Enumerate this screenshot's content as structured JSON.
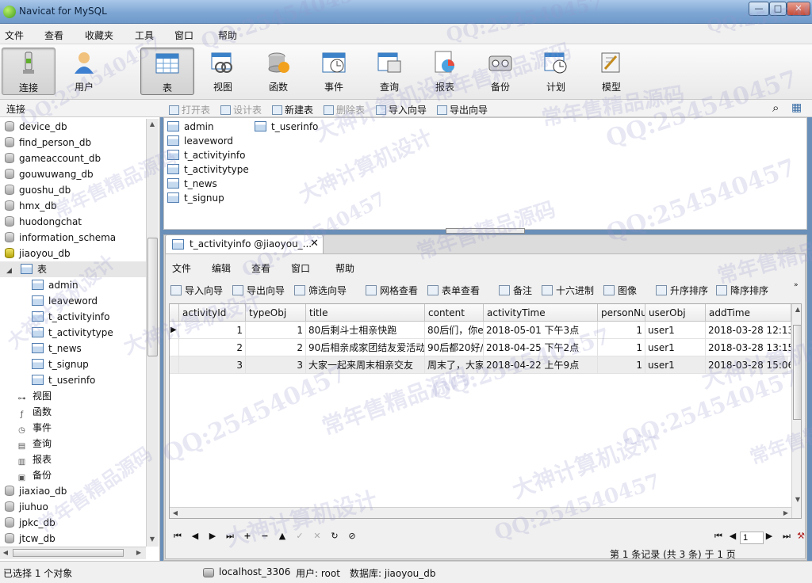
{
  "window": {
    "title": "Navicat for MySQL",
    "min": "—",
    "max": "□",
    "close": "✕"
  },
  "menu": [
    "文件",
    "查看",
    "收藏夹",
    "工具",
    "窗口",
    "帮助"
  ],
  "toolbar": [
    {
      "label": "连接",
      "icon": "connection-icon"
    },
    {
      "label": "用户",
      "icon": "user-icon"
    },
    {
      "label": "表",
      "icon": "table-icon",
      "active": true
    },
    {
      "label": "视图",
      "icon": "view-icon"
    },
    {
      "label": "函数",
      "icon": "function-icon"
    },
    {
      "label": "事件",
      "icon": "event-icon"
    },
    {
      "label": "查询",
      "icon": "query-icon"
    },
    {
      "label": "报表",
      "icon": "report-icon"
    },
    {
      "label": "备份",
      "icon": "backup-icon"
    },
    {
      "label": "计划",
      "icon": "schedule-icon"
    },
    {
      "label": "模型",
      "icon": "model-icon"
    }
  ],
  "sidebar_header": "连接",
  "object_toolbar": [
    {
      "label": "打开表",
      "disabled": true
    },
    {
      "label": "设计表",
      "disabled": true
    },
    {
      "label": "新建表",
      "disabled": false
    },
    {
      "label": "删除表",
      "disabled": true
    },
    {
      "label": "导入向导",
      "disabled": false
    },
    {
      "label": "导出向导",
      "disabled": false
    }
  ],
  "tree": {
    "dbs_top": [
      "device_db",
      "find_person_db",
      "gameaccount_db",
      "gouwuwang_db",
      "guoshu_db",
      "hmx_db",
      "huodongchat",
      "information_schema"
    ],
    "open_db": "jiaoyou_db",
    "tables_node": "表",
    "tables": [
      "admin",
      "leaveword",
      "t_activityinfo",
      "t_activitytype",
      "t_news",
      "t_signup",
      "t_userinfo"
    ],
    "objects": [
      "视图",
      "函数",
      "事件",
      "查询",
      "报表",
      "备份"
    ],
    "dbs_bottom": [
      "jiaxiao_db",
      "jiuhuo",
      "jpkc_db",
      "jtcw_db"
    ]
  },
  "object_list": [
    "admin",
    "leaveword",
    "t_activityinfo",
    "t_activitytype",
    "t_news",
    "t_signup",
    "t_userinfo"
  ],
  "doc_tab": {
    "label": "t_activityinfo @jiaoyou_...",
    "close": "✕"
  },
  "doc_menu": [
    "文件",
    "编辑",
    "查看",
    "窗口",
    "帮助"
  ],
  "doc_toolbar": [
    "导入向导",
    "导出向导",
    "筛选向导",
    "网格查看",
    "表单查看",
    "备注",
    "十六进制",
    "图像",
    "升序排序",
    "降序排序"
  ],
  "grid": {
    "columns": [
      "activityId",
      "typeObj",
      "title",
      "content",
      "activityTime",
      "personNu",
      "userObj",
      "addTime"
    ],
    "rows": [
      [
        "1",
        "1",
        "80后剩斗士相亲快跑",
        "80后们，你e",
        "2018-05-01 下午3点",
        "1",
        "user1",
        "2018-03-28 12:13:"
      ],
      [
        "2",
        "2",
        "90后相亲成家团结友爱活动",
        "90后都20好/",
        "2018-04-25 下午2点",
        "1",
        "user1",
        "2018-03-28 13:15:"
      ],
      [
        "3",
        "3",
        "大家一起来周末相亲交友",
        "周末了，大家",
        "2018-04-22 上午9点",
        "1",
        "user1",
        "2018-03-28 15:06:"
      ]
    ],
    "current_row": 0
  },
  "nav": {
    "page": "1",
    "record_status": "第 1 条记录 (共 3 条) 于 1 页"
  },
  "status": {
    "selected": "已选择 1 个对象",
    "host": "localhost_3306",
    "user": "用户: root",
    "database": "数据库: jiaoyou_db"
  },
  "watermarks": [
    "QQ:254540457",
    "大神计算机设计",
    "常年售精品源码"
  ]
}
